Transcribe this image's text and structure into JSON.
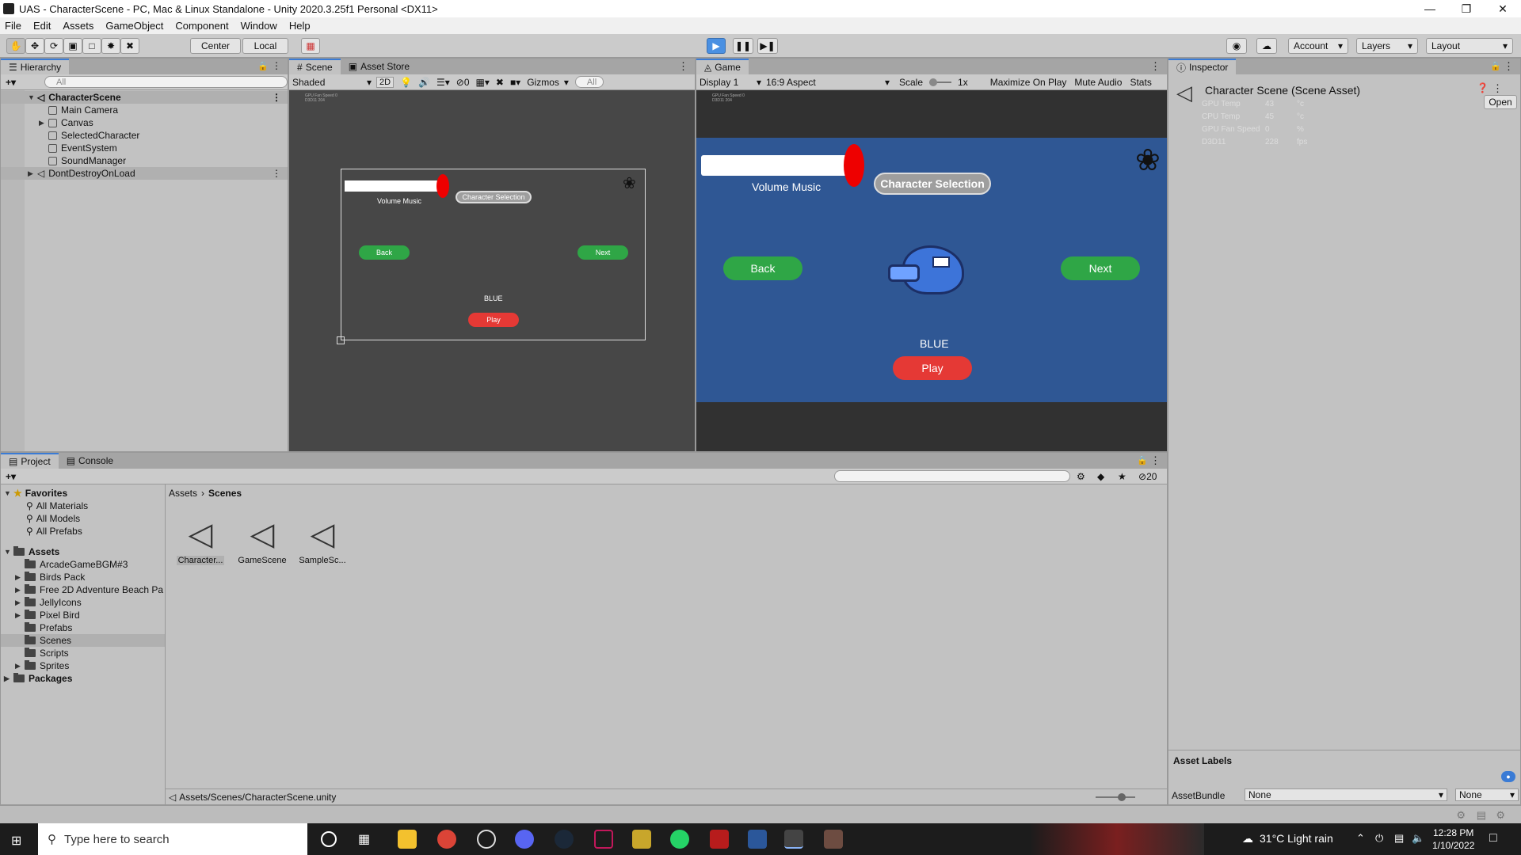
{
  "window": {
    "title": "UAS - CharacterScene - PC, Mac & Linux Standalone - Unity 2020.3.25f1 Personal <DX11>"
  },
  "menu": [
    "File",
    "Edit",
    "Assets",
    "GameObject",
    "Component",
    "Window",
    "Help"
  ],
  "toolbar": {
    "center_label": "Center",
    "local_label": "Local",
    "account_label": "Account",
    "layers_label": "Layers",
    "layout_label": "Layout"
  },
  "hierarchy": {
    "tab": "Hierarchy",
    "search_placeholder": "All",
    "scene": "CharacterScene",
    "items": [
      "Main Camera",
      "Canvas",
      "SelectedCharacter",
      "EventSystem",
      "SoundManager"
    ],
    "ddol": "DontDestroyOnLoad"
  },
  "scene_view": {
    "tabs": [
      "Scene",
      "Asset Store"
    ],
    "shaded": "Shaded",
    "mode2d": "2D",
    "hidden_count": "0",
    "gizmos": "Gizmos",
    "search_placeholder": "All",
    "volume_label": "Volume Music",
    "char_sel": "Character Selection",
    "back": "Back",
    "next": "Next",
    "char_name": "BLUE",
    "play": "Play",
    "stat_lines": [
      "GPU Fan Speed  0",
      "D3D11  204"
    ]
  },
  "game_view": {
    "tab": "Game",
    "display": "Display 1",
    "aspect": "16:9 Aspect",
    "scale_label": "Scale",
    "scale_value": "1x",
    "maximize": "Maximize On Play",
    "mute": "Mute Audio",
    "stats": "Stats",
    "volume_label": "Volume Music",
    "char_sel": "Character Selection",
    "back": "Back",
    "next": "Next",
    "char_name": "BLUE",
    "play": "Play",
    "stat_lines": [
      "GPU Fan Speed  0",
      "D3D11  204"
    ]
  },
  "inspector": {
    "tab": "Inspector",
    "title": "Character Scene (Scene Asset)",
    "open": "Open",
    "stats": [
      {
        "label": "GPU Temp",
        "value": "43",
        "unit": "°c"
      },
      {
        "label": "CPU Temp",
        "value": "45",
        "unit": "°c"
      },
      {
        "label": "GPU Fan Speed",
        "value": "0",
        "unit": "%"
      },
      {
        "label": "D3D11",
        "value": "228",
        "unit": "fps"
      }
    ],
    "asset_labels": "Asset Labels",
    "asset_bundle": "AssetBundle",
    "bundle_value": "None",
    "variant_value": "None"
  },
  "project": {
    "tabs": [
      "Project",
      "Console"
    ],
    "favorites": "Favorites",
    "fav_items": [
      "All Materials",
      "All Models",
      "All Prefabs"
    ],
    "assets": "Assets",
    "folders": [
      "ArcadeGameBGM#3",
      "Birds Pack",
      "Free 2D Adventure Beach Pa",
      "JellyIcons",
      "Pixel Bird",
      "Prefabs",
      "Scenes",
      "Scripts",
      "Sprites"
    ],
    "packages": "Packages",
    "breadcrumb": [
      "Assets",
      "Scenes"
    ],
    "files": [
      "Character...",
      "GameScene",
      "SampleSc..."
    ],
    "hidden_count": "20",
    "path": "Assets/Scenes/CharacterScene.unity"
  },
  "taskbar": {
    "search": "Type here to search",
    "weather": "31°C  Light rain",
    "time": "12:28 PM",
    "date": "1/10/2022"
  }
}
